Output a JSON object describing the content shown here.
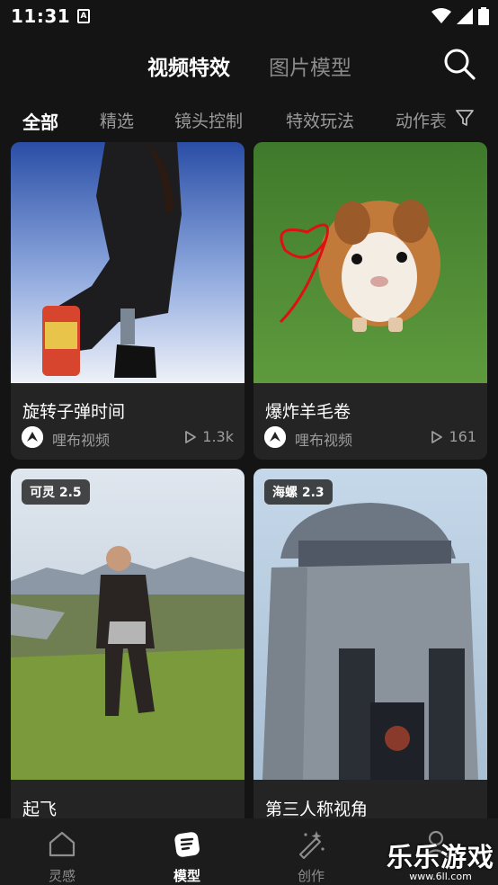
{
  "status_bar": {
    "time": "11:31",
    "app_indicator": "A"
  },
  "header": {
    "tabs": [
      {
        "label": "视频特效",
        "active": true
      },
      {
        "label": "图片模型",
        "active": false
      }
    ],
    "search_icon": "search-icon"
  },
  "categories": [
    {
      "label": "全部",
      "active": true
    },
    {
      "label": "精选"
    },
    {
      "label": "镜头控制"
    },
    {
      "label": "特效玩法"
    },
    {
      "label": "动作表"
    }
  ],
  "filter_icon": "filter-icon",
  "cards": [
    {
      "title": "旋转子弹时间",
      "author": "哩布视频",
      "plays": "1.3k"
    },
    {
      "title": "爆炸羊毛卷",
      "author": "哩布视频",
      "plays": "161"
    },
    {
      "title": "起飞",
      "badge": "可灵 2.5"
    },
    {
      "title": "第三人称视角",
      "badge": "海螺 2.3"
    }
  ],
  "bottom_nav": [
    {
      "label": "灵感",
      "icon": "home-icon",
      "active": false
    },
    {
      "label": "模型",
      "icon": "model-icon",
      "active": true
    },
    {
      "label": "创作",
      "icon": "magic-wand-icon",
      "active": false
    },
    {
      "label": "",
      "icon": "profile-icon",
      "active": false
    }
  ],
  "watermark": {
    "main": "乐乐游戏",
    "sub": "www.6ll.com"
  },
  "colors": {
    "background": "#141414",
    "card": "#242424",
    "nav": "#1c1c1c",
    "muted": "#9a9a9a"
  }
}
